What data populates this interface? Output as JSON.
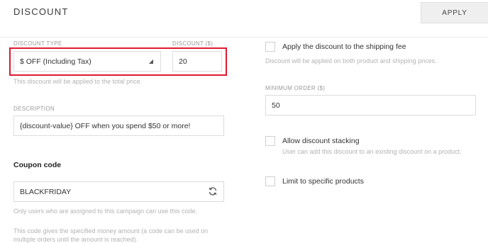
{
  "header": {
    "title": "DISCOUNT",
    "apply_label": "APPLY"
  },
  "discount_type": {
    "label": "DISCOUNT TYPE",
    "value": "$ OFF (Including Tax)",
    "hint": "This discount will be applied to the total price."
  },
  "discount_amount": {
    "label": "DISCOUNT ($)",
    "value": "20"
  },
  "description": {
    "label": "DESCRIPTION",
    "value": "{discount-value} OFF when you spend $50 or more!"
  },
  "coupon": {
    "title": "Coupon code",
    "value": "BLACKFRIDAY",
    "hint1": "Only users who are assigned to this campaign can use this code.",
    "hint2_line1": "This code gives the specified money amount (a code can be used on",
    "hint2_line2": "multiple orders until the amount is reached)."
  },
  "shipping": {
    "label": "Apply the discount to the shipping fee",
    "hint": "Discount will be applied on both product and shipping prices.",
    "checked": false
  },
  "minimum_order": {
    "label": "MINIMUM ORDER ($)",
    "value": "50"
  },
  "stacking": {
    "label": "Allow discount stacking",
    "hint": "User can add this discount to an existing discount on a product.",
    "checked": false
  },
  "specific_products": {
    "label": "Limit to specific products",
    "checked": false
  },
  "colors": {
    "highlight": "#e0192f",
    "apply_bg": "#efefef"
  },
  "icons": {
    "select_caret": "caret-icon",
    "refresh": "refresh-icon"
  }
}
